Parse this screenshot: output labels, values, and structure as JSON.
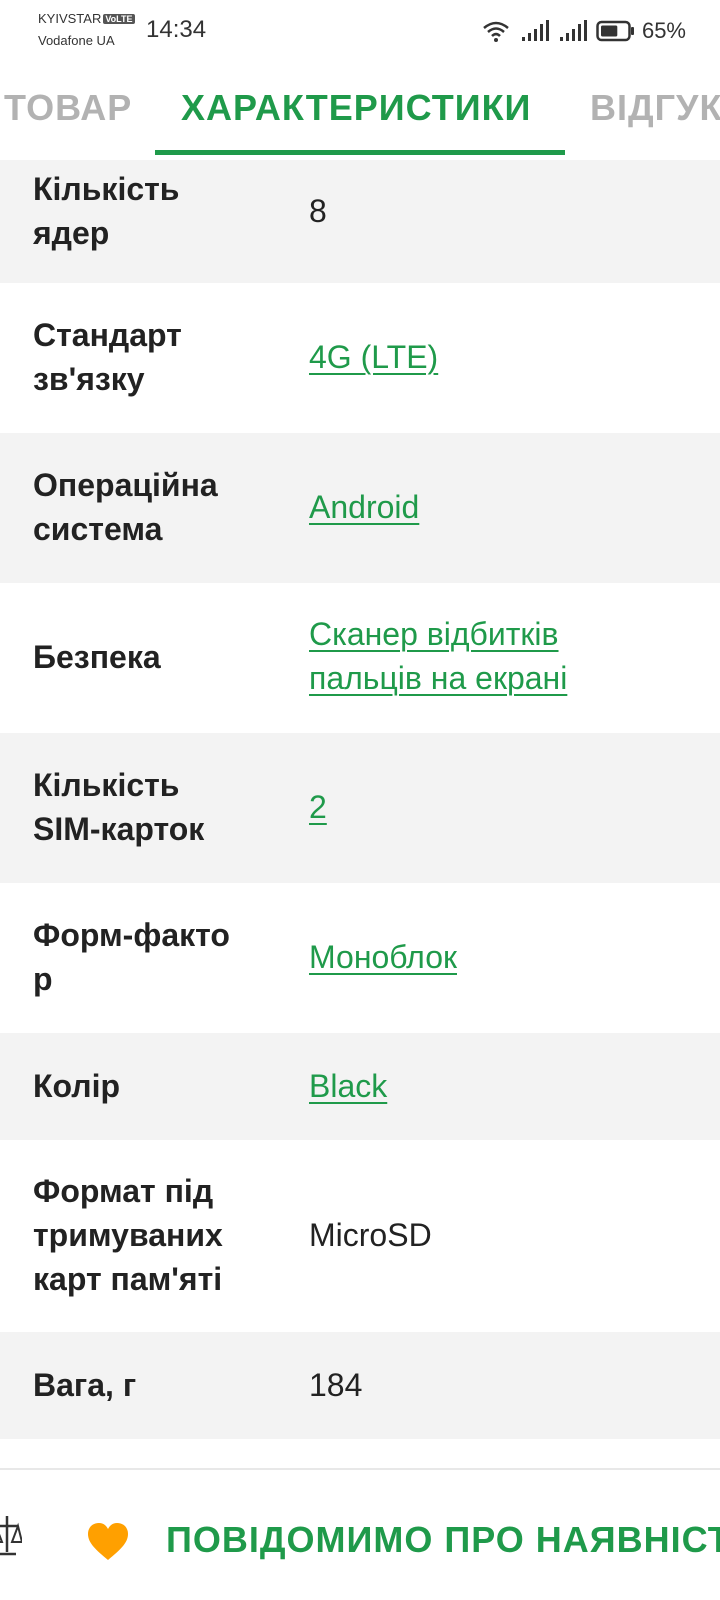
{
  "status_bar": {
    "carrier_1": "KYIVSTAR",
    "volte_badge": "VoLTE",
    "carrier_2": "Vodafone UA",
    "time": "14:34",
    "battery_percent": "65%",
    "battery_level": 0.65,
    "icons": [
      "wifi-icon",
      "signal-icon",
      "signal-icon",
      "battery-icon"
    ]
  },
  "tabs": [
    {
      "label": "ТОВАР",
      "active": false
    },
    {
      "label": "ХАРАКТЕРИСТИКИ",
      "active": true
    },
    {
      "label": "ВІДГУКИ",
      "active": false
    }
  ],
  "specs": [
    {
      "label": "Кількість\nядер",
      "value": "8",
      "link": false
    },
    {
      "label": "Стандарт\nзв'язку",
      "value": "4G (LTE)",
      "link": true
    },
    {
      "label": "Операційна\nсистема",
      "value": "Android",
      "link": true
    },
    {
      "label": "Безпека",
      "value": "Сканер відбитків\nпальців на екрані",
      "link": true
    },
    {
      "label": "Кількість\nSIM-карток",
      "value": "2",
      "link": true
    },
    {
      "label": "Форм-факто\nр",
      "value": "Моноблок",
      "link": true
    },
    {
      "label": "Колір",
      "value": "Black",
      "link": true
    },
    {
      "label": "Формат під\nтримуваних\nкарт пам'яті",
      "value": "MicroSD",
      "link": false
    },
    {
      "label": "Вага, г",
      "value": "184",
      "link": false
    }
  ],
  "bottom_bar": {
    "notify_label": "ПОВІДОМИМО ПРО НАЯВНІСТЬ",
    "icons": [
      "compare-icon",
      "heart-icon"
    ]
  },
  "colors": {
    "accent_green": "#1f9a4a",
    "inactive_tab": "#b2b2b2",
    "row_shade": "#f3f3f3",
    "heart": "#ffa000"
  }
}
